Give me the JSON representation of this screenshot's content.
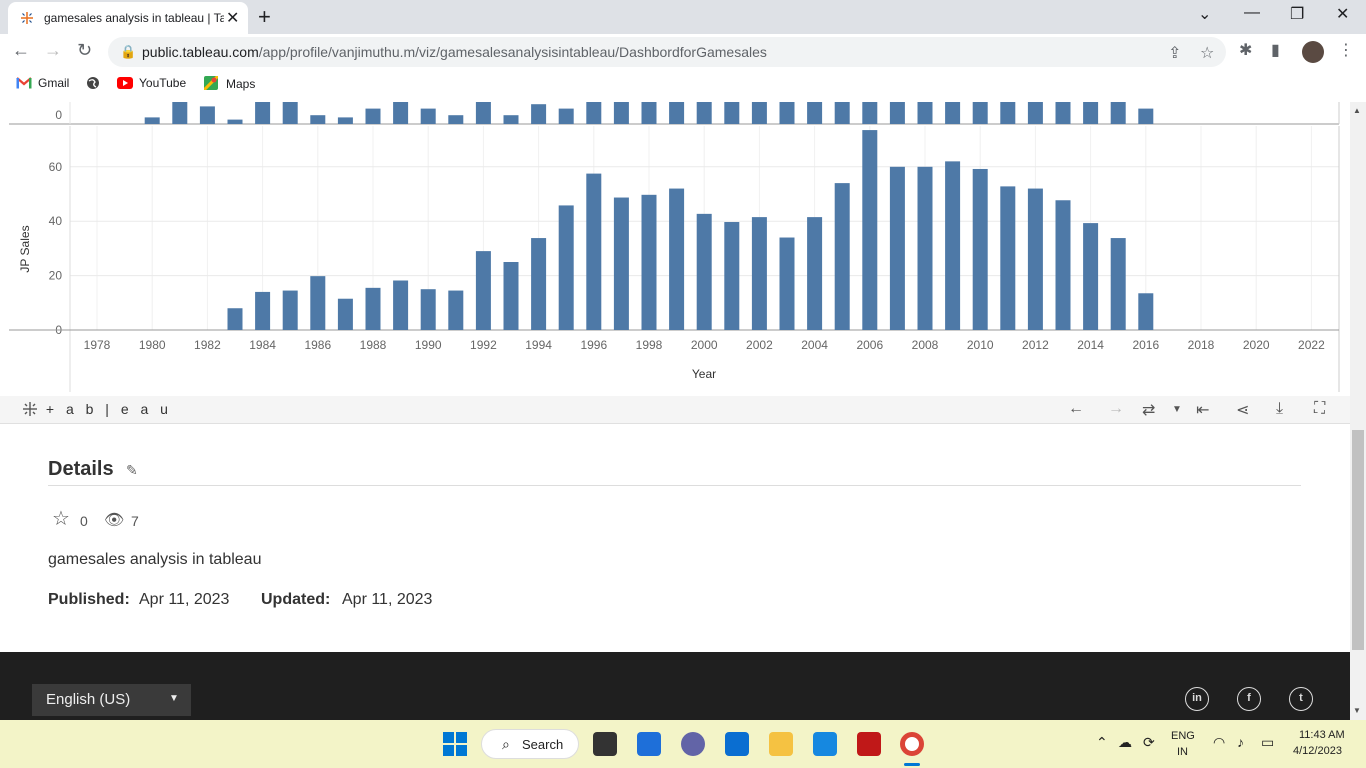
{
  "browser": {
    "tab_title": "gamesales analysis in tableau | Ta",
    "url_host": "public.tableau.com",
    "url_path": "/app/profile/vanjimuthu.m/viz/gamesalesanalysisintableau/DashbordforGamesales",
    "bookmarks": [
      "Gmail",
      "YouTube",
      "Maps"
    ]
  },
  "chart_data": {
    "type": "bar",
    "ylabel": "JP Sales",
    "xlabel": "Year",
    "ylim": [
      0,
      75
    ],
    "yticks": [
      0,
      20,
      40,
      60
    ],
    "xticks": [
      "1978",
      "1980",
      "1982",
      "1984",
      "1986",
      "1988",
      "1990",
      "1992",
      "1994",
      "1996",
      "1998",
      "2000",
      "2002",
      "2004",
      "2006",
      "2008",
      "2010",
      "2012",
      "2014",
      "2016",
      "2018",
      "2020",
      "2022"
    ],
    "categories": [
      1983,
      1984,
      1985,
      1986,
      1987,
      1988,
      1989,
      1990,
      1991,
      1992,
      1993,
      1994,
      1995,
      1996,
      1997,
      1998,
      1999,
      2000,
      2001,
      2002,
      2003,
      2004,
      2005,
      2006,
      2007,
      2008,
      2009,
      2010,
      2011,
      2012,
      2013,
      2014,
      2015,
      2016
    ],
    "values": [
      8,
      14,
      14.5,
      19.8,
      11.5,
      15.5,
      18.2,
      15,
      14.5,
      29,
      25,
      33.8,
      45.8,
      57.5,
      48.7,
      49.7,
      52,
      42.7,
      39.7,
      41.5,
      34,
      41.5,
      54,
      73.5,
      60,
      60,
      62,
      59.2,
      52.8,
      52,
      47.7,
      39.3,
      33.8,
      13.5
    ],
    "top_axis_tick": "0",
    "top_panel_years": [
      1980,
      1981,
      1982,
      1983,
      1984,
      1985,
      1986,
      1987,
      1988,
      1989,
      1990,
      1991,
      1992,
      1993,
      1994,
      1995,
      1996,
      1997,
      1998,
      1999,
      2000,
      2001,
      2002,
      2003,
      2004,
      2005,
      2006,
      2007,
      2008,
      2009,
      2010,
      2011,
      2012,
      2013,
      2014,
      2015,
      2016
    ],
    "top_panel_values": [
      0.3,
      1,
      0.8,
      0.2,
      1,
      1,
      0.4,
      0.3,
      0.7,
      1,
      0.7,
      0.4,
      1,
      0.4,
      0.9,
      0.7,
      1,
      1,
      1,
      1,
      1,
      1,
      1,
      1,
      1,
      1,
      1,
      1,
      1,
      1,
      1,
      1,
      1,
      1,
      1,
      1,
      0.7
    ]
  },
  "tableau": {
    "logo_text": "+ a b | e a u"
  },
  "details": {
    "heading": "Details",
    "favorites": "0",
    "views": "7",
    "description": "gamesales analysis in tableau",
    "published_label": "Published:",
    "published_value": "Apr 11, 2023",
    "updated_label": "Updated:",
    "updated_value": "Apr 11, 2023"
  },
  "footer": {
    "language": "English (US)",
    "social": [
      "in",
      "f",
      "t"
    ]
  },
  "taskbar": {
    "search_label": "Search",
    "lang_top": "ENG",
    "lang_bottom": "IN",
    "time": "11:43 AM",
    "date": "4/12/2023"
  },
  "colors": {
    "bar": "#4e79a7"
  }
}
